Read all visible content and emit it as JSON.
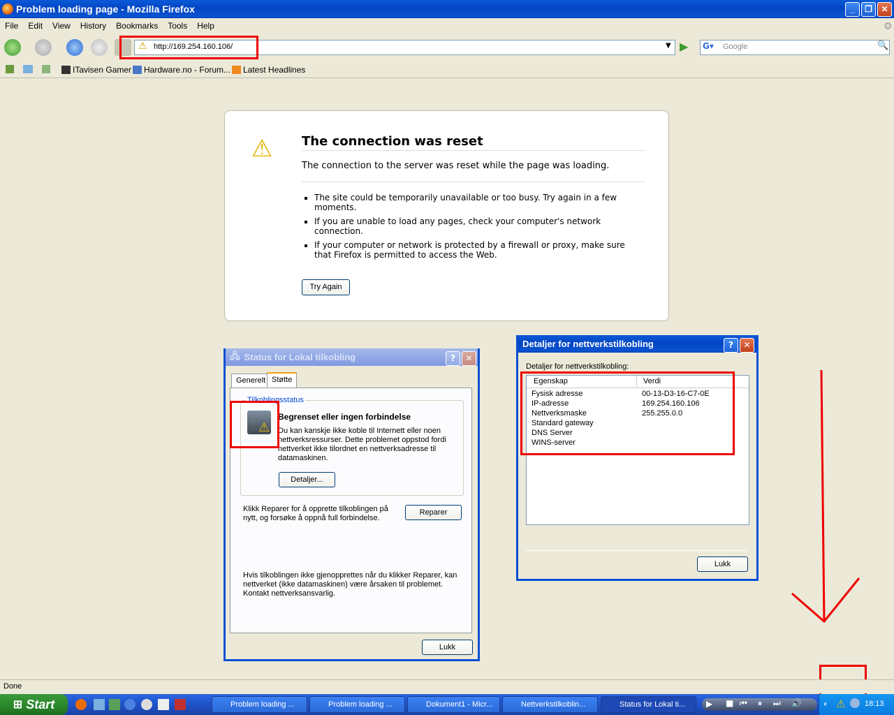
{
  "window": {
    "title": "Problem loading page - Mozilla Firefox"
  },
  "menu": [
    "File",
    "Edit",
    "View",
    "History",
    "Bookmarks",
    "Tools",
    "Help"
  ],
  "navigation": {
    "url": "http://169.254.160.106/",
    "search_placeholder": "Google"
  },
  "bookmarks": [
    "ITavisen Gamer",
    "Hardware.no - Forum...",
    "Latest Headlines"
  ],
  "error_page": {
    "title": "The connection was reset",
    "subtitle": "The connection to the server was reset while the page was loading.",
    "bullets": [
      "The site could be temporarily unavailable or too busy. Try again in a few moments.",
      "If you are unable to load any pages, check your computer's network connection.",
      "If your computer or network is protected by a firewall or proxy, make sure that Firefox is permitted to access the Web."
    ],
    "button": "Try Again"
  },
  "status_dialog": {
    "title": "Status for Lokal tilkobling",
    "tabs": [
      "Generelt",
      "Støtte"
    ],
    "group_label": "Tilkoblingsstatus",
    "status_heading": "Begrenset eller ingen forbindelse",
    "status_text": "Du kan kanskje ikke koble til Internett eller noen nettverksressurser. Dette problemet oppstod fordi nettverket ikke tilordnet en nettverksadresse til datamaskinen.",
    "details_button": "Detaljer...",
    "repair_text": "Klikk Reparer for å opprette tilkoblingen på nytt, og forsøke å oppnå full forbindelse.",
    "repair_button": "Reparer",
    "contact_text": "Hvis tilkoblingen ikke gjenopprettes når du klikker Reparer, kan nettverket (ikke datamaskinen) være årsaken til problemet. Kontakt nettverksansvarlig.",
    "close_button": "Lukk"
  },
  "details_dialog": {
    "title": "Detaljer for nettverkstilkobling",
    "label": "Detaljer for nettverkstilkobling:",
    "columns": [
      "Egenskap",
      "Verdi"
    ],
    "rows": [
      {
        "prop": "Fysisk adresse",
        "value": "00-13-D3-16-C7-0E"
      },
      {
        "prop": "IP-adresse",
        "value": "169.254.160.106"
      },
      {
        "prop": "Nettverksmaske",
        "value": "255.255.0.0"
      },
      {
        "prop": "Standard gateway",
        "value": ""
      },
      {
        "prop": "DNS Server",
        "value": ""
      },
      {
        "prop": "WINS-server",
        "value": ""
      }
    ],
    "close_button": "Lukk"
  },
  "statusbar": {
    "text": "Done"
  },
  "taskbar": {
    "start": "Start",
    "buttons": [
      "Problem loading ...",
      "Problem loading ...",
      "Dokument1 - Micr...",
      "Nettverkstilkoblin...",
      "Status for Lokal ti..."
    ],
    "clock": "18:13"
  }
}
